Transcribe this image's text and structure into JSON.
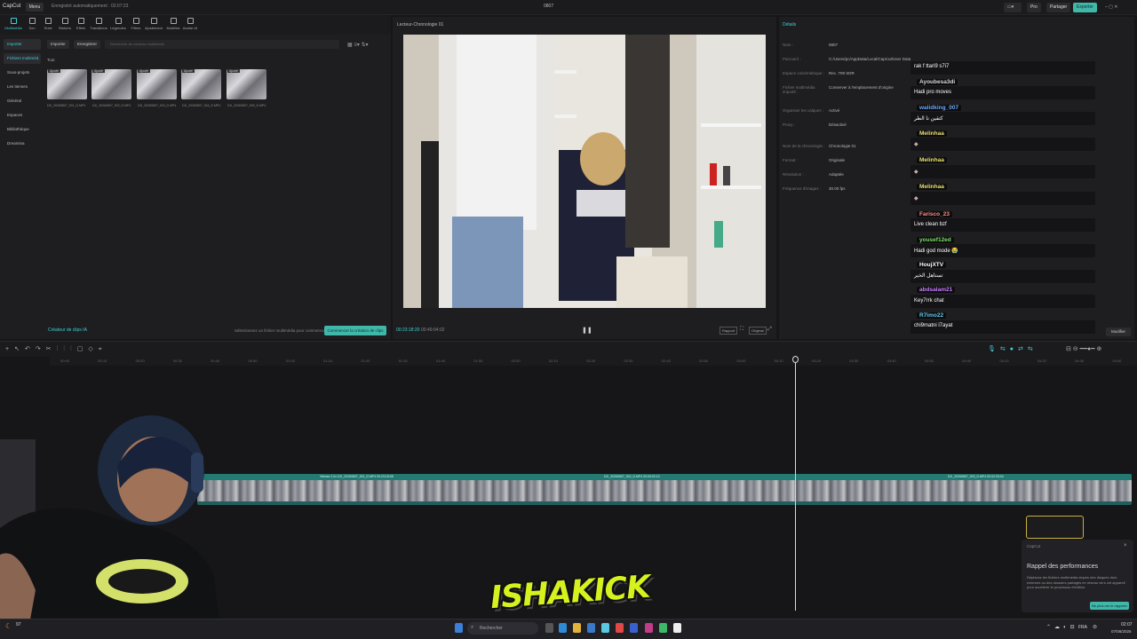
{
  "app": {
    "logo": "CapCut",
    "menu_label": "Menu",
    "autosave": "Enregistré automatiquement : 02:07:23",
    "project_name": "0807",
    "pro_label": "Pro",
    "share_label": "Partager",
    "export_label": "Exporter"
  },
  "toolbar": {
    "items": [
      {
        "label": "Multimédia"
      },
      {
        "label": "Son"
      },
      {
        "label": "Texte"
      },
      {
        "label": "Stickers"
      },
      {
        "label": "Effets"
      },
      {
        "label": "Transitions"
      },
      {
        "label": "Légendes"
      },
      {
        "label": "Filtres"
      },
      {
        "label": "Ajustement"
      },
      {
        "label": "Modèles"
      },
      {
        "label": "Avatar IA"
      }
    ]
  },
  "media": {
    "sidebar": [
      {
        "label": "Importer"
      },
      {
        "label": "Fichiers multiméd."
      },
      {
        "label": "Sous-projets"
      },
      {
        "label": "Les tiennes"
      },
      {
        "label": "Général"
      },
      {
        "label": "Espaces"
      },
      {
        "label": "Bibliothèque"
      },
      {
        "label": "Dreamina"
      }
    ],
    "import_btn": "Importer",
    "record_btn": "Enregistrer",
    "search_placeholder": "Recherche de contenu multimédia",
    "filter_label": "Tout",
    "added_tag": "Ajouté",
    "thumbs": [
      {
        "name": "DJI_20260807_001_D.MP4"
      },
      {
        "name": "DJI_20260807_002_D.MP4"
      },
      {
        "name": "DJI_20260807_003_D.MP4"
      },
      {
        "name": "DJI_20260807_004_D.MP4"
      },
      {
        "name": "DJI_20260807_005_D.MP4"
      }
    ],
    "clip_creator": "Créateur de clips IA",
    "hint": "Sélectionnez un fichier multimédia pour commencer",
    "command_btn": "Commencer la création de clips"
  },
  "player": {
    "title": "Lecteur-Chronologie 01",
    "time_current": "00:23:18:20",
    "time_total": "00:49:04:02",
    "ratio_btn": "Rapport",
    "full_btn": "Original"
  },
  "details": {
    "title": "Détails",
    "rows": [
      {
        "k": "Nom :",
        "v": "0807"
      },
      {
        "k": "Parcourir :",
        "v": "C:/Users/pc/AppData/Local/CapCut/User Data/Projects/0807"
      },
      {
        "k": "Espace colorimétrique :",
        "v": "Rec. 709 SDR"
      },
      {
        "k": "Fichier multimédia importé :",
        "v": "Conserver à l'emplacement d'origine"
      },
      {
        "k": "Organiser les calques :",
        "v": "Activé"
      },
      {
        "k": "Proxy :",
        "v": "Désactivé"
      },
      {
        "k": "Nom de la chronologie :",
        "v": "Chronologie 01"
      },
      {
        "k": "Format :",
        "v": "Originale"
      },
      {
        "k": "Résolution :",
        "v": "Adaptée"
      },
      {
        "k": "Fréquence d'images :",
        "v": "30.00 fps"
      }
    ],
    "modify_btn": "Modifier"
  },
  "chat": [
    {
      "user": "",
      "msg": "rak f ttari9 s7i7",
      "color": "#ffffff"
    },
    {
      "user": "Ayoubesa3di",
      "msg": "Hadi pro moves",
      "color": "#d8d8d8"
    },
    {
      "user": "walidking_007",
      "msg": "كتقين نا الطر",
      "color": "#6aa6ff"
    },
    {
      "user": "Melinhaa",
      "msg": "",
      "color": "#e8e070"
    },
    {
      "user": "Melinhaa",
      "msg": "",
      "color": "#e8e070"
    },
    {
      "user": "Melinhaa",
      "msg": "",
      "color": "#e8e070"
    },
    {
      "user": "Farisco_23",
      "msg": "Live clean bzf",
      "color": "#ff8a8a"
    },
    {
      "user": "yousef12ed",
      "msg": "Hadi god mode 😭",
      "color": "#7ddf6a"
    },
    {
      "user": "HoujXTV",
      "msg": "تستاهل الخير",
      "color": "#ffffff"
    },
    {
      "user": "abdsalam21",
      "msg": "Key7rrk chat",
      "color": "#c87dff"
    },
    {
      "user": "R7imo22",
      "msg": "chi9matni l7ayat",
      "color": "#5fc9f0"
    }
  ],
  "timeline": {
    "ticks": [
      "00:00",
      "00:10",
      "00:20",
      "00:30",
      "00:40",
      "00:50",
      "01:00",
      "01:10",
      "01:20",
      "01:30",
      "01:40",
      "01:50",
      "02:00",
      "02:10",
      "02:20",
      "02:30",
      "02:40",
      "02:50",
      "03:00",
      "03:10",
      "03:20",
      "03:30",
      "03:40",
      "03:50",
      "04:00",
      "04:10",
      "04:20",
      "04:30",
      "04:40",
      "04:50"
    ],
    "clip_labels": [
      "Vitesse 2.0x  DJI_20260807_001_D.MP4  00:23:18:08",
      "DJI_20260807_002_D.MP4  00:09:02:10",
      "DJI_20260807_003_D.MP4  00:02:33:04"
    ]
  },
  "notification": {
    "app": "CapCut",
    "title": "Rappel des performances",
    "body": "Déplacez les fichiers multimédia depuis des disques durs externes ou des dossiers partagés en réseau vers cet appareil pour accélérer le processus d'édition.",
    "button": "Ne plus me le rappeler"
  },
  "taskbar": {
    "weather": "97",
    "search": "Rechercher",
    "lang": "FRA",
    "time": "02:07",
    "date": "07/08/2026"
  },
  "overlay": {
    "logo": "ISHAKICK"
  }
}
